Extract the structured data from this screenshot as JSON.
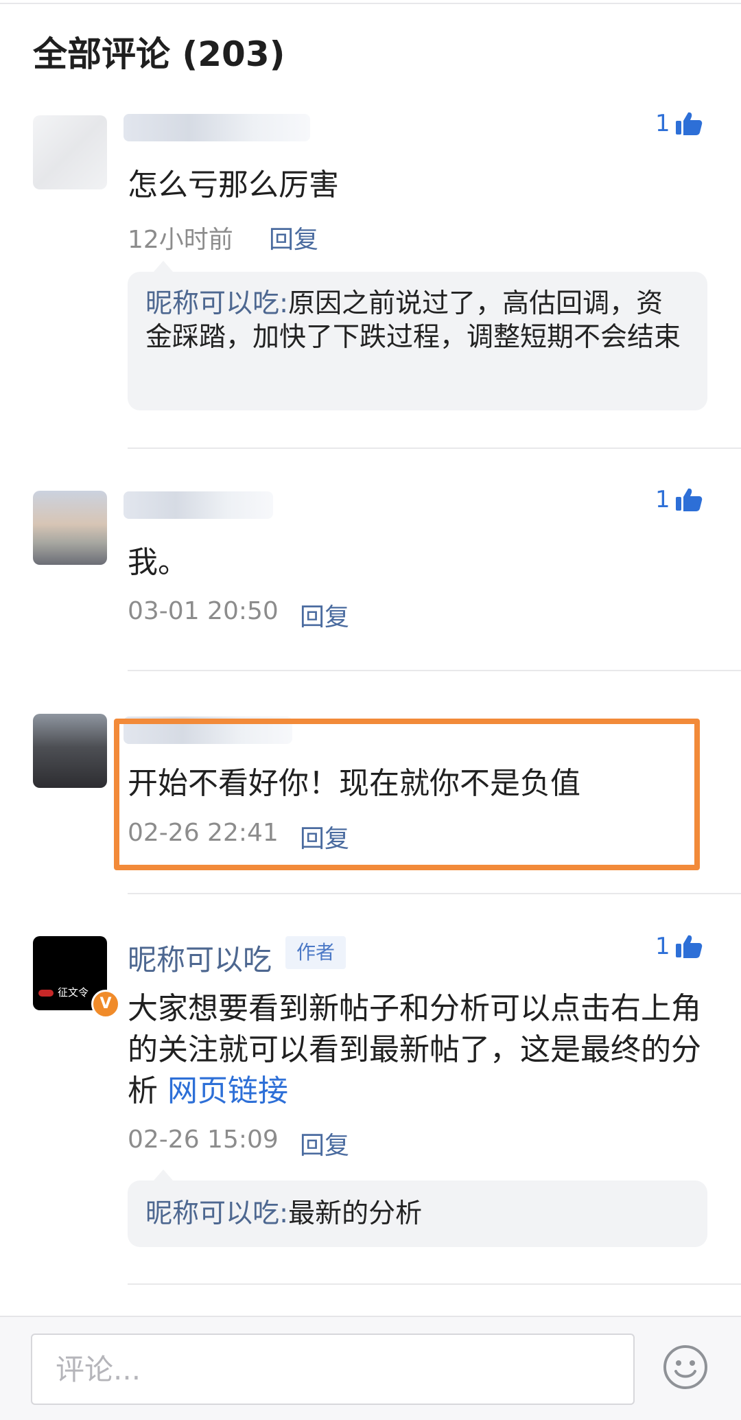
{
  "section_title": "全部评论 (203)",
  "comments": [
    {
      "like_count": "1",
      "text": "怎么亏那么厉害",
      "time": "12小时前",
      "reply_label": "回复",
      "replies": [
        {
          "name": "昵称可以吃:",
          "text": "原因之前说过了，高估回调，资金踩踏，加快了下跌过程，调整短期不会结束"
        }
      ]
    },
    {
      "like_count": "1",
      "text": "我。",
      "time": "03-01 20:50",
      "reply_label": "回复"
    },
    {
      "text": "开始不看好你！现在就你不是负值",
      "time": "02-26 22:41",
      "reply_label": "回复"
    },
    {
      "author_name": "昵称可以吃",
      "author_badge": "作者",
      "like_count": "1",
      "text": "大家想要看到新帖子和分析可以点击右上角的关注就可以看到最新帖了，这是最终的分析",
      "link_text": "网页链接",
      "time": "02-26 15:09",
      "reply_label": "回复",
      "replies": [
        {
          "name": "昵称可以吃:",
          "text": "最新的分析"
        }
      ],
      "avatar_brand": "征文令",
      "verified_badge": "V"
    }
  ],
  "bottom_bar": {
    "placeholder": "评论..."
  },
  "colors": {
    "like_blue": "#2d6fd7",
    "reply_name_blue": "#4d6790",
    "highlight_orange": "#f28a39"
  },
  "icons": {
    "like": "thumbs-up-icon",
    "emoji": "emoji-icon"
  }
}
